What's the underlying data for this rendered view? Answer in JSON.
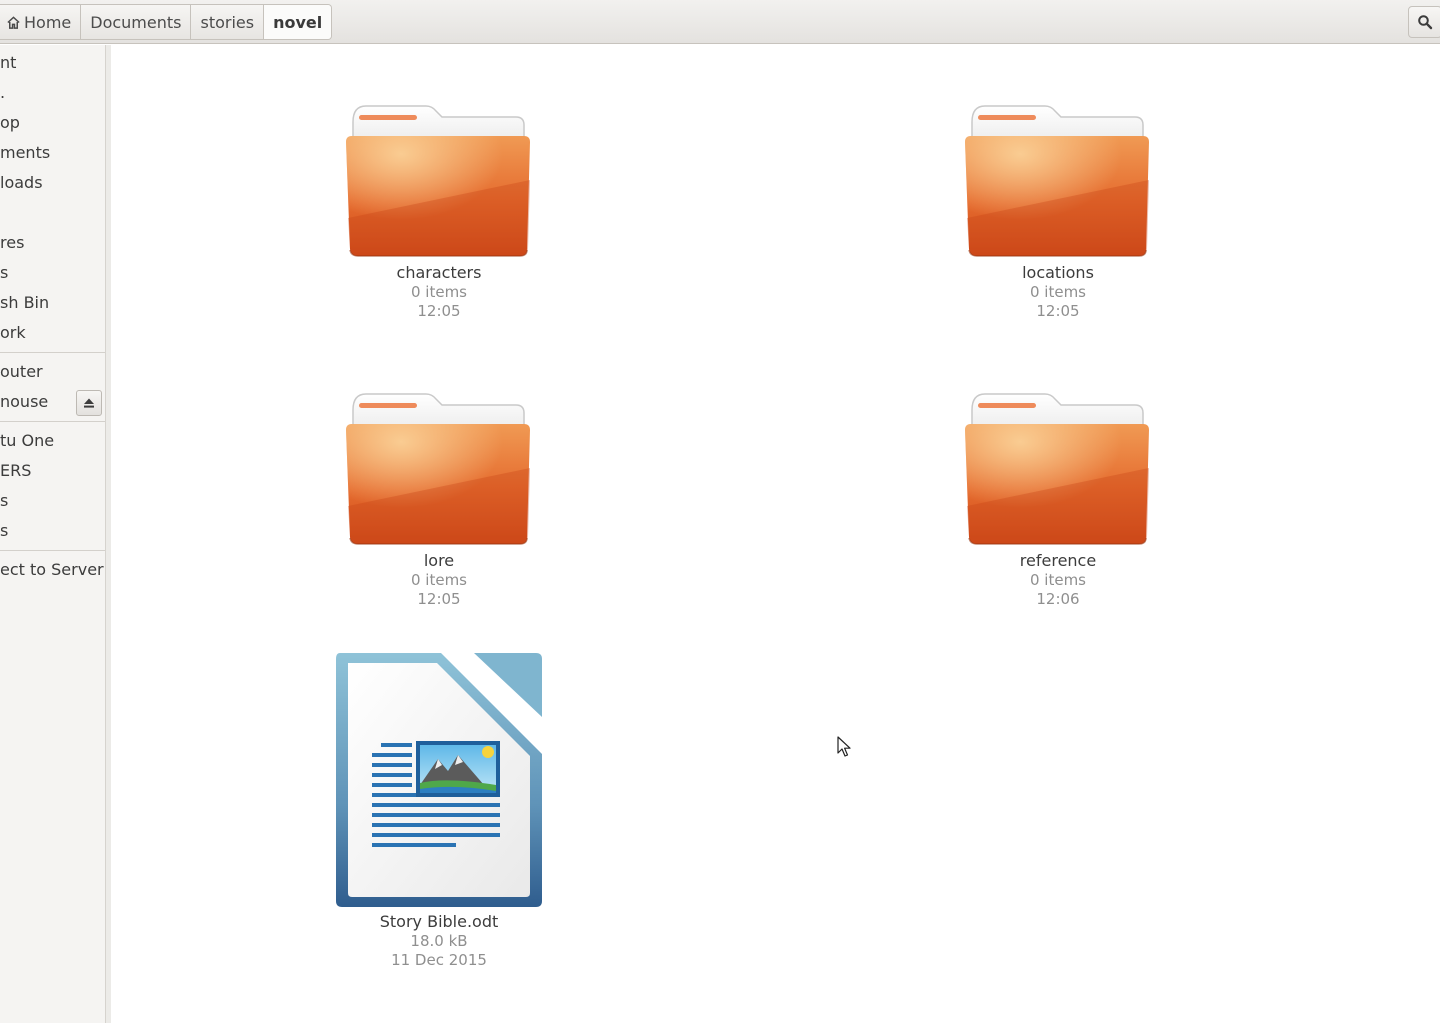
{
  "breadcrumb": {
    "items": [
      {
        "label": "Home",
        "icon": "home-icon"
      },
      {
        "label": "Documents"
      },
      {
        "label": "stories"
      },
      {
        "label": "novel",
        "active": true
      }
    ]
  },
  "search": {
    "icon": "search-icon"
  },
  "sidebar": {
    "items": [
      {
        "label": "nt"
      },
      {
        "label": "."
      },
      {
        "label": "op"
      },
      {
        "label": "ments"
      },
      {
        "label": "loads"
      },
      {
        "label": ""
      },
      {
        "label": "res"
      },
      {
        "label": "s"
      },
      {
        "label": "sh Bin"
      },
      {
        "label": "ork"
      },
      {
        "label": "outer"
      },
      {
        "label": "nouse"
      },
      {
        "label": "tu One"
      },
      {
        "label": "ERS"
      },
      {
        "label": "s"
      },
      {
        "label": "s"
      },
      {
        "label": "ect to Server"
      }
    ]
  },
  "files": [
    {
      "name": "characters",
      "meta1": "0 items",
      "meta2": "12:05",
      "kind": "folder"
    },
    {
      "name": "locations",
      "meta1": "0 items",
      "meta2": "12:05",
      "kind": "folder"
    },
    {
      "name": "lore",
      "meta1": "0 items",
      "meta2": "12:05",
      "kind": "folder"
    },
    {
      "name": "reference",
      "meta1": "0 items",
      "meta2": "12:06",
      "kind": "folder"
    },
    {
      "name": "Story Bible.odt",
      "meta1": "18.0 kB",
      "meta2": "11 Dec 2015",
      "kind": "document"
    }
  ],
  "colors": {
    "folder": "#e0622b",
    "document_frame": "#3a6f9e",
    "accent": "#e77d3e"
  }
}
